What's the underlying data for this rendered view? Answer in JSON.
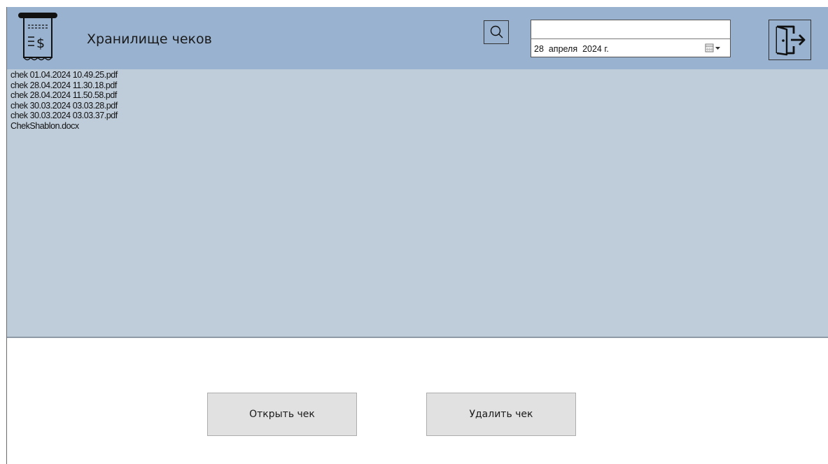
{
  "app": {
    "title": "Хранилище чеков"
  },
  "search": {
    "value": "",
    "placeholder": ""
  },
  "date_picker": {
    "value": "28  апреля  2024 г."
  },
  "files": [
    "chek 01.04.2024 10.49.25.pdf",
    "chek 28.04.2024 11.30.18.pdf",
    "chek 28.04.2024 11.50.58.pdf",
    "chek 30.03.2024 03.03.28.pdf",
    "chek 30.03.2024 03.03.37.pdf",
    "ChekShablon.docx"
  ],
  "buttons": {
    "open_label": "Открыть чек",
    "delete_label": "Удалить чек"
  },
  "icons": {
    "app": "receipt-icon",
    "search": "search-icon",
    "calendar": "calendar-dropdown-icon",
    "exit": "exit-door-icon"
  },
  "colors": {
    "header_bg": "#98b2d0",
    "list_bg": "#bfcddb",
    "button_bg": "#e1e1e1"
  }
}
